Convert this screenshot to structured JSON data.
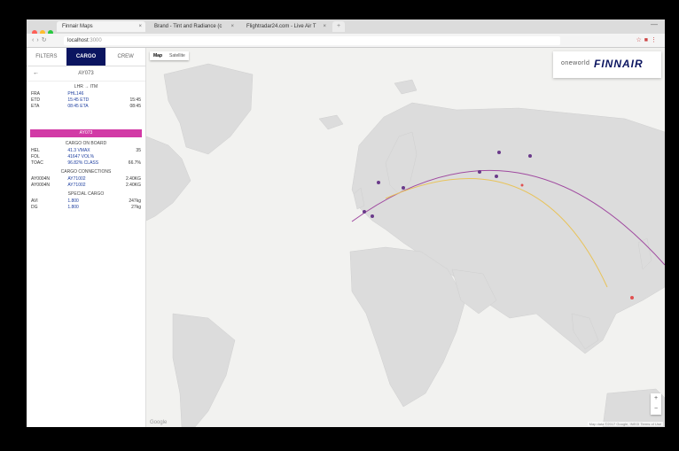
{
  "browser": {
    "tabs": [
      {
        "label": "Finnair Maps",
        "active": true
      },
      {
        "label": "Brand - Tint and Radiance (c",
        "active": false
      },
      {
        "label": "Flightradar24.com - Live Air T",
        "active": false
      }
    ],
    "address": {
      "host": "localhost",
      "port": ":3000"
    },
    "colors": {
      "traffic": [
        "#fe5f57",
        "#febc2e",
        "#28c840"
      ]
    }
  },
  "sidebar": {
    "tabs": [
      {
        "label": "FILTERS",
        "active": false
      },
      {
        "label": "CARGO",
        "active": true
      },
      {
        "label": "CREW",
        "active": false
      }
    ],
    "flight_code": "AY073",
    "route": {
      "header": "LHR → ITM",
      "rows": [
        [
          "FRA",
          "PHL146",
          ""
        ],
        [
          "ETD",
          "15:45  ETD",
          "15:45"
        ],
        [
          "ETA",
          "08:45  ETA",
          "08:45"
        ]
      ]
    },
    "highlight_label": "AY073",
    "cargo_onboard": {
      "header": "CARGO ON BOARD",
      "rows": [
        [
          "HEL",
          "41.3  VMAX",
          "35"
        ],
        [
          "FOL",
          "41647  VOL%",
          ""
        ],
        [
          "TOAC",
          "96.82%  CLASS",
          "66.7%"
        ]
      ]
    },
    "cargo_connections": {
      "header": "CARGO CONNECTIONS",
      "rows": [
        [
          "AY0004N",
          "AY71002",
          "2.40KG"
        ],
        [
          "AY0004N",
          "AY71002",
          "2.40KG"
        ]
      ]
    },
    "special_cargo": {
      "header": "SPECIAL CARGO",
      "rows": [
        [
          "AVI",
          "1.800",
          "247kg"
        ],
        [
          "DG",
          "1.800",
          "27kg"
        ]
      ]
    }
  },
  "map": {
    "type_buttons": [
      "Map",
      "Satellite"
    ],
    "brand": {
      "alliance": "oneworld",
      "name": "FINNAIR"
    },
    "zoom": [
      "+",
      "−"
    ],
    "attribution": "Map data ©2017 Google, INEGI  Terms of Use",
    "google": "Google",
    "colors": {
      "route_primary": "#a04aa0",
      "route_secondary": "#e8c35a",
      "land": "#dcdcdc",
      "water": "#f2f2f0"
    }
  }
}
